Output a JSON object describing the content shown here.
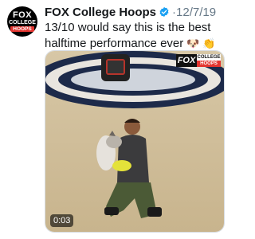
{
  "account": {
    "avatar_icon": "fox-college-hoops-logo-icon",
    "avatar_fox": "FOX",
    "avatar_college": "COLLEGE",
    "avatar_hoops": "HOOPS",
    "name": "FOX College Hoops",
    "verified_icon": "verified-badge-icon",
    "separator": "·",
    "date": "12/7/19"
  },
  "tweet": {
    "text": "13/10 would say this is the best halftime performance ever",
    "emojis": "🐶 👏 👏"
  },
  "media": {
    "type": "video",
    "duration": "0:03",
    "watermark_fox": "FOX",
    "watermark_college": "COLLEGE",
    "watermark_hoops": "HOOPS"
  },
  "colors": {
    "text": "#14171a",
    "secondary": "#657786",
    "verified": "#1da1f2",
    "brand_red": "#e3342f"
  }
}
